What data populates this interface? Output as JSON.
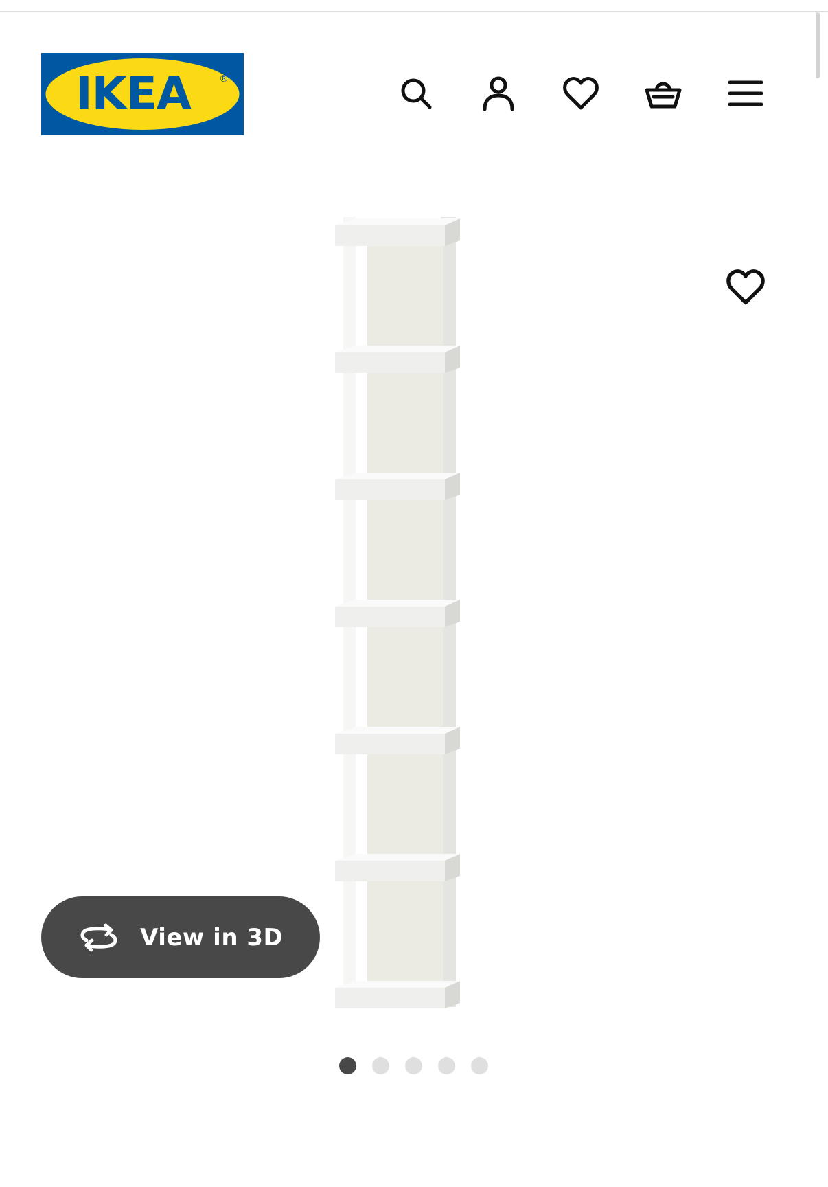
{
  "header": {
    "logo": {
      "text": "IKEA",
      "registered_mark": "®",
      "colors": {
        "background": "#0058A3",
        "oval": "#FBD914",
        "text": "#0058A3"
      }
    },
    "icons": [
      "search-icon",
      "account-icon",
      "wishlist-heart-icon",
      "shopping-basket-icon",
      "menu-icon"
    ]
  },
  "product": {
    "image_icons": [
      "favourite-heart-icon"
    ],
    "view_3d": {
      "label": "View in 3D",
      "icon": "rotate-3d-icon"
    },
    "carousel": {
      "total": 5,
      "active_index": 0
    }
  },
  "colors": {
    "text_dark": "#111111",
    "button_bg": "#484848",
    "dot_active": "#484848",
    "dot_inactive": "#dfdfdf"
  }
}
